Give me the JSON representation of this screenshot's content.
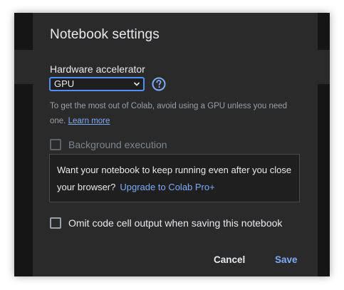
{
  "dialog": {
    "title": "Notebook settings",
    "hardware_accelerator": {
      "label": "Hardware accelerator",
      "selected": "GPU",
      "help_icon": "question-circle-icon",
      "hint_text": "To get the most out of Colab, avoid using a GPU unless you need one.",
      "learn_more": "Learn more"
    },
    "background_execution": {
      "label": "Background execution",
      "checked": false,
      "disabled": true
    },
    "promo": {
      "text": "Want your notebook to keep running even after you close your browser?",
      "link": "Upgrade to Colab Pro+"
    },
    "omit_output": {
      "label": "Omit code cell output when saving this notebook",
      "checked": false
    },
    "buttons": {
      "cancel": "Cancel",
      "save": "Save"
    }
  },
  "colors": {
    "dialog_background": "#2a2a2a",
    "accent": "#7cacf8",
    "focus_border": "#4d90fe",
    "text_primary": "#e8eaed",
    "text_secondary": "#9aa0a6"
  }
}
